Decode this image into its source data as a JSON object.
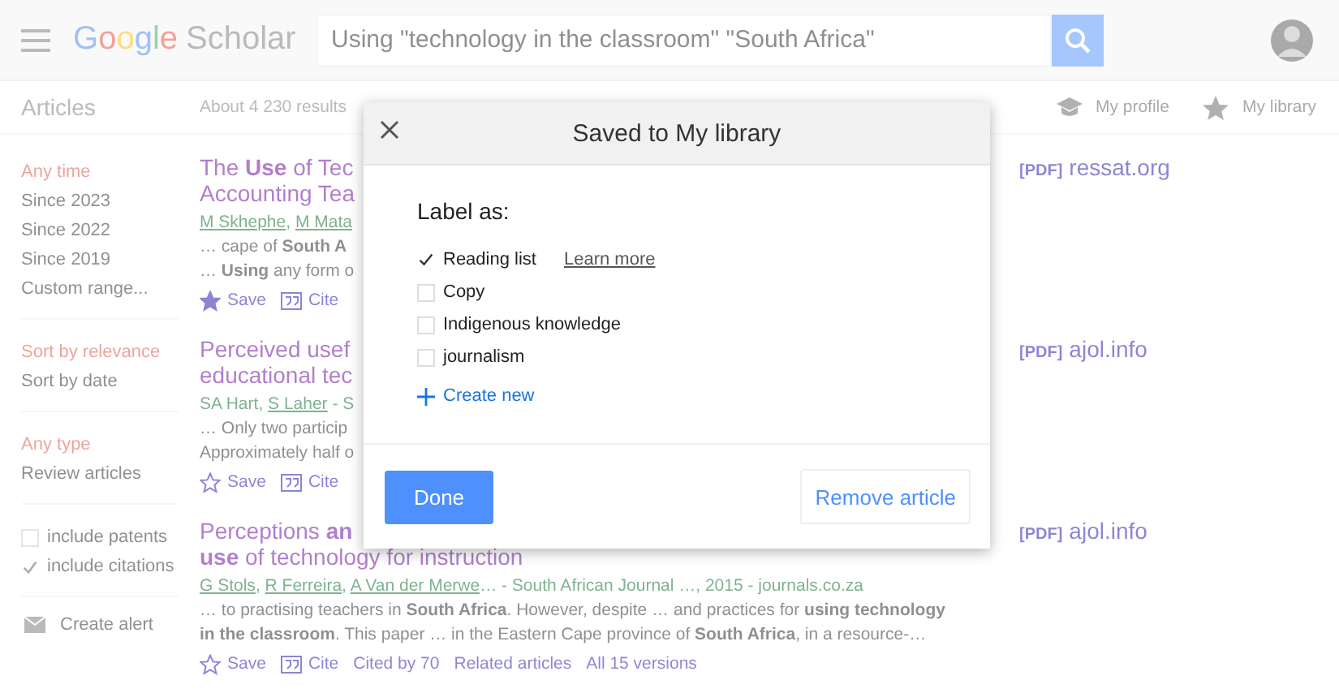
{
  "header": {
    "logo": {
      "brand": "Google",
      "product": "Scholar"
    },
    "search": {
      "value": "Using \"technology in the classroom\" \"South Africa\""
    }
  },
  "subheader": {
    "section": "Articles",
    "results_count": "About 4 230 results",
    "links": [
      {
        "kind": "profile",
        "label": "My profile"
      },
      {
        "kind": "library",
        "label": "My library"
      }
    ]
  },
  "sidebar": {
    "groups": [
      {
        "kind": "links",
        "items": [
          {
            "label": "Any time",
            "selected": true
          },
          {
            "label": "Since 2023",
            "selected": false
          },
          {
            "label": "Since 2022",
            "selected": false
          },
          {
            "label": "Since 2019",
            "selected": false
          },
          {
            "label": "Custom range...",
            "selected": false
          }
        ]
      },
      {
        "kind": "links",
        "items": [
          {
            "label": "Sort by relevance",
            "selected": true
          },
          {
            "label": "Sort by date",
            "selected": false
          }
        ]
      },
      {
        "kind": "links",
        "items": [
          {
            "label": "Any type",
            "selected": true
          },
          {
            "label": "Review articles",
            "selected": false
          }
        ]
      },
      {
        "kind": "checks",
        "items": [
          {
            "label": "include patents",
            "checked": false
          },
          {
            "label": "include citations",
            "checked": true
          }
        ]
      }
    ],
    "alert": "Create alert"
  },
  "results": [
    {
      "title_lines": [
        "The **Use** of Tec",
        "Accounting Tea"
      ],
      "authors": [
        {
          "name": "M Skhephe",
          "linked": true,
          "after": ", "
        },
        {
          "name": "M Mata",
          "linked": true
        }
      ],
      "snippet_lines": [
        "… cape of **South A**",
        "… **Using** any form o"
      ],
      "saved": true,
      "actions": [
        {
          "kind": "save",
          "label": "Save"
        },
        {
          "kind": "cite",
          "label": "Cite"
        }
      ],
      "pdf": {
        "tag": "[PDF]",
        "domain": "ressat.org"
      }
    },
    {
      "title_lines": [
        "Perceived usef",
        "educational tec"
      ],
      "authors": [
        {
          "name": "SA Hart",
          "linked": false,
          "after": ", "
        },
        {
          "name": "S Laher",
          "linked": true
        }
      ],
      "source": " - S",
      "snippet_lines": [
        "… Only two particip",
        "Approximately half o"
      ],
      "saved": false,
      "actions": [
        {
          "kind": "save",
          "label": "Save"
        },
        {
          "kind": "cite",
          "label": "Cite"
        }
      ],
      "pdf": {
        "tag": "[PDF]",
        "domain": "ajol.info"
      }
    },
    {
      "title_lines": [
        "Perceptions **an**",
        "**use** of technology for instruction"
      ],
      "authors": [
        {
          "name": "G Stols",
          "linked": true,
          "after": ", "
        },
        {
          "name": "R Ferreira",
          "linked": true,
          "after": ", "
        },
        {
          "name": "A Van der Merwe",
          "linked": true
        }
      ],
      "source": "… - South African Journal …, 2015 - journals.co.za",
      "snippet_lines": [
        "… to practising teachers in **South Africa**. However, despite … and practices for **using technology**",
        "**in the classroom**. This paper … in the Eastern Cape province of **South Africa**, in a resource-…"
      ],
      "saved": false,
      "actions": [
        {
          "kind": "save",
          "label": "Save"
        },
        {
          "kind": "cite",
          "label": "Cite"
        },
        {
          "kind": "link",
          "label": "Cited by 70"
        },
        {
          "kind": "link",
          "label": "Related articles"
        },
        {
          "kind": "link",
          "label": "All 15 versions"
        }
      ],
      "pdf": {
        "tag": "[PDF]",
        "domain": "ajol.info"
      }
    }
  ],
  "dialog": {
    "title": "Saved to My library",
    "prompt": "Label as:",
    "labels": [
      {
        "label": "Reading list",
        "checked": true,
        "link": "Learn more"
      },
      {
        "label": "Copy",
        "checked": false
      },
      {
        "label": "Indigenous knowledge",
        "checked": false
      },
      {
        "label": "journalism",
        "checked": false
      }
    ],
    "create": "Create new",
    "buttons": [
      {
        "kind": "primary",
        "label": "Done"
      },
      {
        "kind": "secondary",
        "label": "Remove article"
      }
    ]
  }
}
